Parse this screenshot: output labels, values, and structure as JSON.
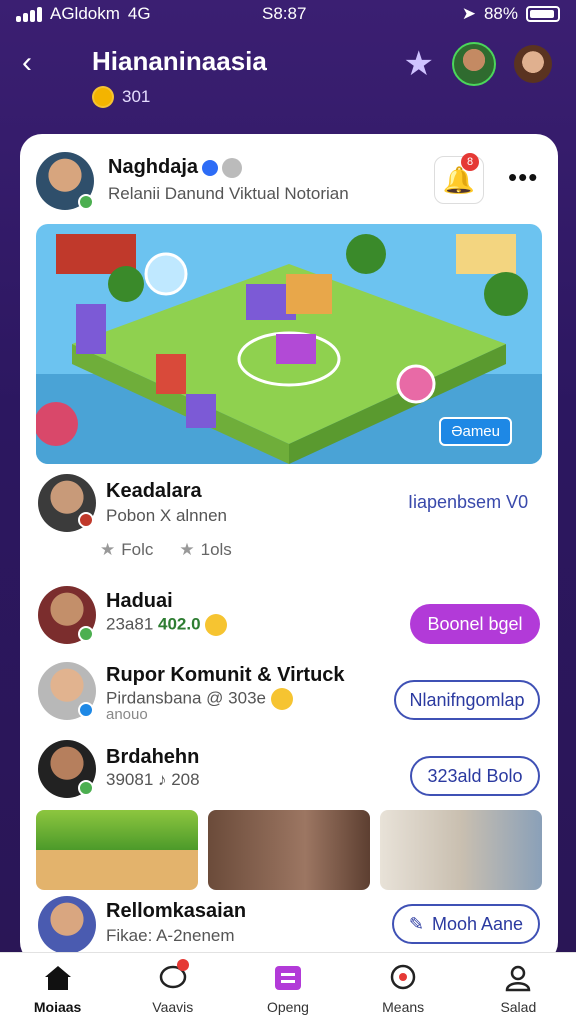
{
  "status": {
    "carrier": "AGldokm",
    "network": "4G",
    "time": "S8:87",
    "battery": "88%",
    "battery_level": 0.88
  },
  "header": {
    "title": "Hiananinaasia",
    "coins": "301"
  },
  "post": {
    "author": "Naghdaja",
    "subtitle": "Relanii Danund Viktual Notorian",
    "notification_count": "8",
    "hero_chip": "Əameu"
  },
  "feed": [
    {
      "name": "Keadalara",
      "subtitle": "Pobon X alnnen",
      "action": "Iiapenbsem V0",
      "meta": [
        "Folc",
        "1ols"
      ]
    },
    {
      "name": "Haduai",
      "subtitle_prefix": "23a81",
      "subtitle_value": "402.0",
      "action": "Boonel bgel"
    },
    {
      "name": "Rupor Komunit & Virtuck",
      "subtitle": "Pirdansbana @ 303e",
      "subtitle2": "anouo",
      "action": "Nlanifngomlap"
    },
    {
      "name": "Brdahehn",
      "subtitle": "39081 ♪ 208",
      "action": "323ald Bolo"
    },
    {
      "name": "Rellomkasaian",
      "subtitle": "Fikae: A-2nenem",
      "action": "Mooh Aane"
    }
  ],
  "tabs": [
    {
      "label": "Moiaas",
      "icon": "home-icon"
    },
    {
      "label": "Vaavis",
      "icon": "chat-icon"
    },
    {
      "label": "Openg",
      "icon": "apps-icon"
    },
    {
      "label": "Means",
      "icon": "message-icon"
    },
    {
      "label": "Salad",
      "icon": "profile-icon"
    }
  ]
}
